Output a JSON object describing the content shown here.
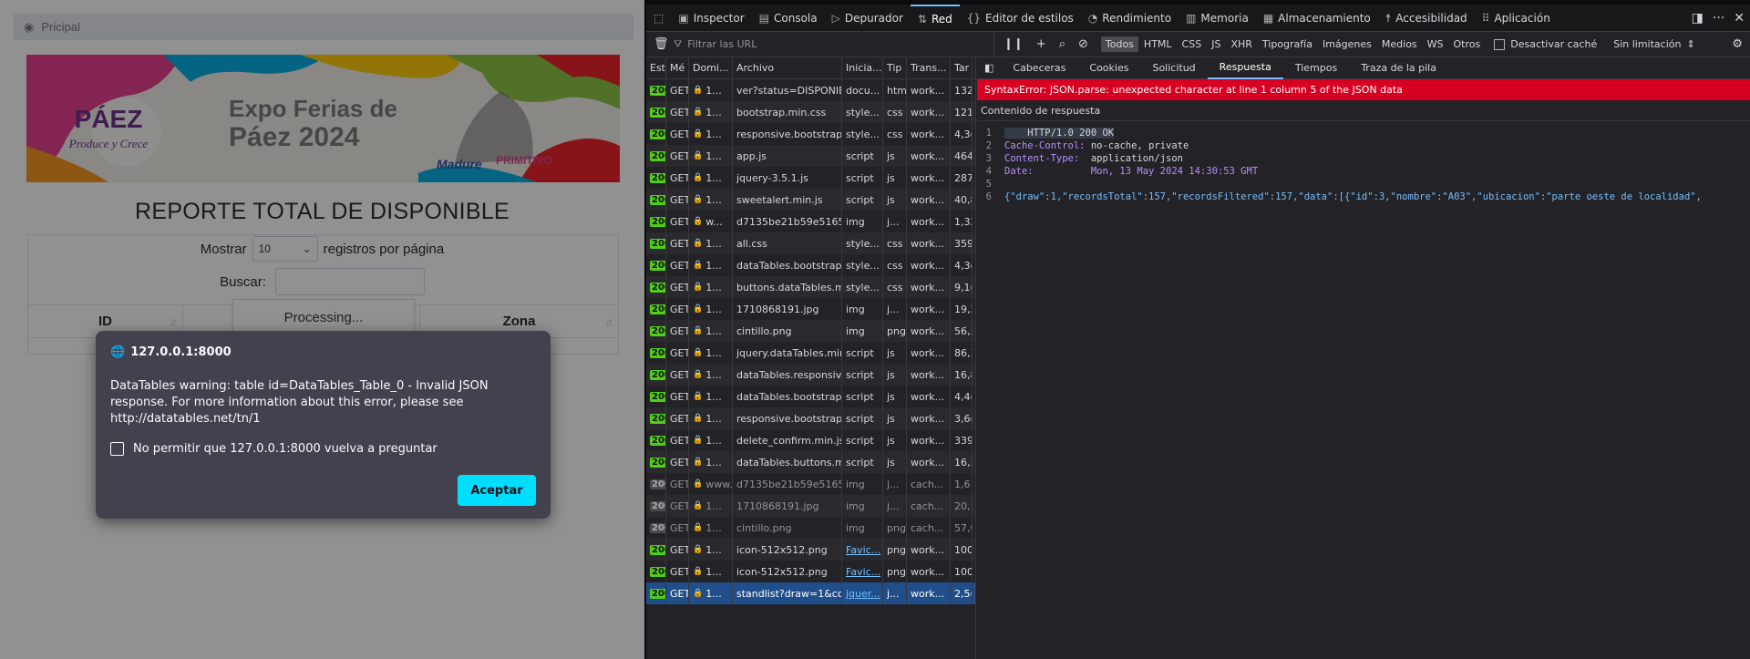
{
  "page": {
    "breadcrumb": "Pricipal",
    "banner": {
      "title_line1": "Expo Ferias de",
      "title_line2": "Páez 2024",
      "logo_text": "PÁEZ",
      "logo_sub": "Produce y Crece",
      "brand1": "Madure",
      "brand2": "PRIMITIVO",
      "brand3": "RAFAEL"
    },
    "report_title": "REPORTE TOTAL DE DISPONIBLE",
    "length": {
      "prefix": "Mostrar",
      "value": "10",
      "suffix": "registros por página"
    },
    "search_label": "Buscar:",
    "columns": [
      "ID",
      "",
      "Zona"
    ],
    "processing": "Processing..."
  },
  "dialog": {
    "origin": "127.0.0.1:8000",
    "message": "DataTables warning: table id=DataTables_Table_0 - Invalid JSON response. For more information about this error, please see http://datatables.net/tn/1",
    "checkbox_label": "No permitir que 127.0.0.1:8000 vuelva a preguntar",
    "accept": "Aceptar"
  },
  "devtools": {
    "tools": [
      "Inspector",
      "Consola",
      "Depurador",
      "Red",
      "Editor de estilos",
      "Rendimiento",
      "Memoria",
      "Almacenamiento",
      "Accesibilidad",
      "Aplicación"
    ],
    "active_tool": "Red",
    "filter_placeholder": "Filtrar las URL",
    "types": [
      "Todos",
      "HTML",
      "CSS",
      "JS",
      "XHR",
      "Tipografía",
      "Imágenes",
      "Medios",
      "WS",
      "Otros"
    ],
    "disable_cache": "Desactivar caché",
    "throttle": "Sin limitación",
    "columns": [
      "Est",
      "Mé",
      "Domi...",
      "Archivo",
      "Inicia...",
      "Tip",
      "Trans...",
      "Tar"
    ],
    "requests": [
      {
        "status": "200",
        "method": "GET",
        "domain": "1...",
        "file": "ver?status=DISPONIBLE",
        "init": "docu...",
        "type": "htm",
        "transfer": "work...",
        "size": "132"
      },
      {
        "status": "200",
        "method": "GET",
        "domain": "1...",
        "file": "bootstrap.min.css",
        "init": "style...",
        "type": "css",
        "transfer": "work...",
        "size": "121"
      },
      {
        "status": "200",
        "method": "GET",
        "domain": "1...",
        "file": "responsive.bootstrap.m",
        "init": "style...",
        "type": "css",
        "transfer": "work...",
        "size": "4,3("
      },
      {
        "status": "200",
        "method": "GET",
        "domain": "1...",
        "file": "app.js",
        "init": "script",
        "type": "js",
        "transfer": "work...",
        "size": "464"
      },
      {
        "status": "200",
        "method": "GET",
        "domain": "1...",
        "file": "jquery-3.5.1.js",
        "init": "script",
        "type": "js",
        "transfer": "work...",
        "size": "287"
      },
      {
        "status": "200",
        "method": "GET",
        "domain": "1...",
        "file": "sweetalert.min.js",
        "init": "script",
        "type": "js",
        "transfer": "work...",
        "size": "40,8"
      },
      {
        "status": "200",
        "method": "GET",
        "domain": "w...",
        "file": "d7135be21b59e51655",
        "init": "img",
        "type": "j...",
        "transfer": "work...",
        "size": "1,32"
      },
      {
        "status": "200",
        "method": "GET",
        "domain": "1...",
        "file": "all.css",
        "init": "style...",
        "type": "css",
        "transfer": "work...",
        "size": "359"
      },
      {
        "status": "200",
        "method": "GET",
        "domain": "1...",
        "file": "dataTables.bootstrap.m",
        "init": "style...",
        "type": "css",
        "transfer": "work...",
        "size": "4,3("
      },
      {
        "status": "200",
        "method": "GET",
        "domain": "1...",
        "file": "buttons.dataTables.min",
        "init": "style...",
        "type": "css",
        "transfer": "work...",
        "size": "9,1("
      },
      {
        "status": "200",
        "method": "GET",
        "domain": "1...",
        "file": "1710868191.jpg",
        "init": "img",
        "type": "j...",
        "transfer": "work...",
        "size": "19,3"
      },
      {
        "status": "200",
        "method": "GET",
        "domain": "1...",
        "file": "cintillo.png",
        "init": "img",
        "type": "png",
        "transfer": "work...",
        "size": "56,3"
      },
      {
        "status": "200",
        "method": "GET",
        "domain": "1...",
        "file": "jquery.dataTables.min.js",
        "init": "script",
        "type": "js",
        "transfer": "work...",
        "size": "86,3"
      },
      {
        "status": "200",
        "method": "GET",
        "domain": "1...",
        "file": "dataTables.responsive.i",
        "init": "script",
        "type": "js",
        "transfer": "work...",
        "size": "16,8"
      },
      {
        "status": "200",
        "method": "GET",
        "domain": "1...",
        "file": "dataTables.bootstrap.m",
        "init": "script",
        "type": "js",
        "transfer": "work...",
        "size": "4,4("
      },
      {
        "status": "200",
        "method": "GET",
        "domain": "1...",
        "file": "responsive.bootstrap.m",
        "init": "script",
        "type": "js",
        "transfer": "work...",
        "size": "3,6("
      },
      {
        "status": "200",
        "method": "GET",
        "domain": "1...",
        "file": "delete_confirm.min.js",
        "init": "script",
        "type": "js",
        "transfer": "work...",
        "size": "339"
      },
      {
        "status": "200",
        "method": "GET",
        "domain": "1...",
        "file": "dataTables.buttons.min",
        "init": "script",
        "type": "js",
        "transfer": "work...",
        "size": "16,3"
      },
      {
        "status": "200",
        "method": "GET",
        "domain": "www...",
        "file": "d7135be21b59e51655",
        "init": "img",
        "type": "j...",
        "transfer": "cach...",
        "size": "1,6",
        "cached": true
      },
      {
        "status": "200",
        "method": "GET",
        "domain": "1...",
        "file": "1710868191.jpg",
        "init": "img",
        "type": "j...",
        "transfer": "cach...",
        "size": "20,1",
        "cached": true
      },
      {
        "status": "200",
        "method": "GET",
        "domain": "1...",
        "file": "cintillo.png",
        "init": "img",
        "type": "png",
        "transfer": "cach...",
        "size": "57,0",
        "cached": true
      },
      {
        "status": "200",
        "method": "GET",
        "domain": "1...",
        "file": "icon-512x512.png",
        "init": "Favic...",
        "type": "png",
        "transfer": "work...",
        "size": "100",
        "link": true
      },
      {
        "status": "200",
        "method": "GET",
        "domain": "1...",
        "file": "icon-512x512.png",
        "init": "Favic...",
        "type": "png",
        "transfer": "work...",
        "size": "100",
        "link": true
      },
      {
        "status": "200",
        "method": "GET",
        "domain": "1...",
        "file": "standlist?draw=1&colu",
        "init": "jquer...",
        "type": "j...",
        "transfer": "work...",
        "size": "2,5(",
        "link": true,
        "selected": true
      }
    ],
    "detail_tabs": [
      "Cabeceras",
      "Cookies",
      "Solicitud",
      "Respuesta",
      "Tiempos",
      "Traza de la pila"
    ],
    "active_detail_tab": "Respuesta",
    "error": "SyntaxError: JSON.parse: unexpected character at line 1 column 5 of the JSON data",
    "response_label": "Contenido de respuesta",
    "code_lines": [
      {
        "n": "1",
        "text": "    HTTP/1.0 200 OK"
      },
      {
        "n": "2",
        "key": "Cache-Control:",
        "val": " no-cache, private"
      },
      {
        "n": "3",
        "key": "Content-Type:",
        "val": "  application/json"
      },
      {
        "n": "4",
        "key": "Date:",
        "val": "          Mon, 13 May 2024 14:30:53 GMT"
      },
      {
        "n": "5",
        "text": ""
      },
      {
        "n": "6",
        "text": "{\"draw\":1,\"recordsTotal\":157,\"recordsFiltered\":157,\"data\":[{\"id\":3,\"nombre\":\"A03\",\"ubicacion\":\"parte oeste de localidad\","
      }
    ]
  }
}
